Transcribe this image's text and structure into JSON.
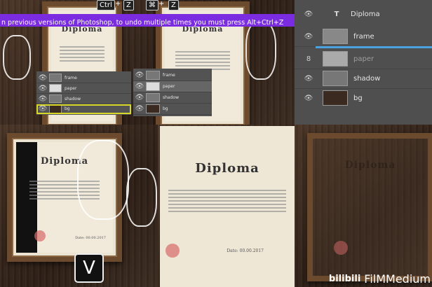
{
  "banner": {
    "text": "n previous versions of Photoshop, to undo multiple times you must press Alt+Ctrl+Z"
  },
  "shortcuts": {
    "ctrl": "Ctrl",
    "plus1": "+",
    "z1": "Z",
    "cmd": "⌘",
    "plus2": "+",
    "z2": "Z"
  },
  "key_v": "V",
  "diploma": {
    "title": "Diploma",
    "date": "Date: 00.00.2017"
  },
  "layers_small_left": [
    {
      "name": "frame"
    },
    {
      "name": "paper"
    },
    {
      "name": "shadow"
    },
    {
      "name": "bg"
    }
  ],
  "layers_small_right": [
    {
      "name": "frame"
    },
    {
      "name": "paper"
    },
    {
      "name": "shadow"
    },
    {
      "name": "bg"
    }
  ],
  "layers_panel": [
    {
      "name": "Diploma",
      "type": "text"
    },
    {
      "name": "frame",
      "type": "image"
    },
    {
      "name": "paper",
      "type": "image"
    },
    {
      "name": "shadow",
      "type": "image"
    },
    {
      "name": "bg",
      "type": "image"
    }
  ],
  "watermark": {
    "logo": "bilibili",
    "text": "FilMMedium"
  },
  "colors": {
    "banner": "#7b2be0",
    "highlight": "#d8d82a",
    "panel": "#535353",
    "wood": "#3b2a1f"
  }
}
